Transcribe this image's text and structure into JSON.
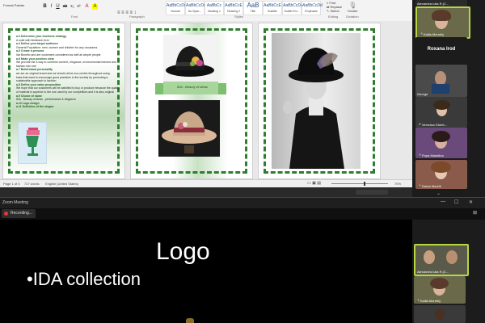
{
  "ribbon": {
    "toolbar_paint": "Format Painter",
    "group_labels": [
      "Font",
      "Paragraph",
      "Styles",
      "Editing",
      "Dictation"
    ],
    "styles": [
      {
        "sample": "AaBbCcDd",
        "label": "Normal"
      },
      {
        "sample": "AaBbCcDd",
        "label": "No Spac..."
      },
      {
        "sample": "AaBbCc",
        "label": "Heading 1"
      },
      {
        "sample": "AaBbCcE",
        "label": "Heading 2"
      },
      {
        "sample": "AaB",
        "label": "Title"
      },
      {
        "sample": "AaBbCcE",
        "label": "Subtitle"
      },
      {
        "sample": "AaBbCcDd",
        "label": "Subtle Em..."
      },
      {
        "sample": "AaBbCcDd",
        "label": "Emphasis"
      }
    ],
    "editing": {
      "find": "Find",
      "replace": "Replace",
      "select": "Select"
    },
    "dictate": "Dictate",
    "font_buttons": [
      "B",
      "I",
      "U",
      "ab",
      "x₂",
      "x²",
      "A",
      "A"
    ]
  },
  "page1": {
    "lines": [
      {
        "t": "a.3  Determine your business strategy",
        "b": true
      },
      {
        "t": "A solid with feedback form",
        "b": false
      },
      {
        "t": "a.4  Define your target audience",
        "b": true
      },
      {
        "t": "General Population: men, women and children for any occasions",
        "b": false
      },
      {
        "t": "a.5  Create a persona",
        "b": true
      },
      {
        "t": "Ida Bonello and are customers considered as well as simple people",
        "b": false
      },
      {
        "t": "a.6  Make your position clear",
        "b": true
      },
      {
        "t": "We provide the a way to combine comfort, elegance, environmental interest and",
        "b": false
      },
      {
        "t": "fashion into one",
        "b": false
      },
      {
        "t": "a.7  Build brand personality",
        "b": true
      },
      {
        "t": "we are an original brand and we should all be eco-centric throughout using",
        "b": false
      },
      {
        "t": "base that want to encourage good practices in the society by promoting a",
        "b": false
      },
      {
        "t": "sustainable approach to fashion",
        "b": false
      },
      {
        "t": "a.8  Define your value proposition",
        "b": true
      },
      {
        "t": "We hope that our customers will be satisfied to buy or produce because the quality",
        "b": false
      },
      {
        "t": "of material is superior to the one used by our competitors and it is also original",
        "b": false
      },
      {
        "t": "a.9  Choice of name",
        "b": true
      },
      {
        "t": "IDA - Beauty of ideas , performance & elegance",
        "b": false
      },
      {
        "t": "a.10  Logo design",
        "b": true
      },
      {
        "t": "a.11  Definition of the slogan",
        "b": true
      }
    ]
  },
  "page2": {
    "banner": "IDA - Beauty of Ideas"
  },
  "statusbar": {
    "page": "Page 1 of 3",
    "words": "727 words",
    "language": "English (United States)",
    "zoom": "70%"
  },
  "participants_top": [
    {
      "name": "Alexandra Iulia R.(C...",
      "top": true
    },
    {
      "name": "Kaiila Morrelly",
      "mic": true
    },
    {
      "name": "Roxana Irod",
      "big": true
    },
    {
      "name": "George",
      "mic": false
    },
    {
      "name": "Veronica Gherb...",
      "mic": true
    },
    {
      "name": "Popa Madalina",
      "mic": true
    },
    {
      "name": "Dama Morelli",
      "mic": true
    }
  ],
  "zoom": {
    "title": "Zoom Meeting",
    "recording": "Recording...",
    "controls": [
      "—",
      "☐",
      "✕"
    ]
  },
  "slide": {
    "title": "Logo",
    "bullet": "•IDA collection"
  },
  "participants_bottom": [
    {
      "name": "Alexandra Iulia R.(C..."
    },
    {
      "name": "Kaiila Morrelly",
      "mic": true
    }
  ]
}
